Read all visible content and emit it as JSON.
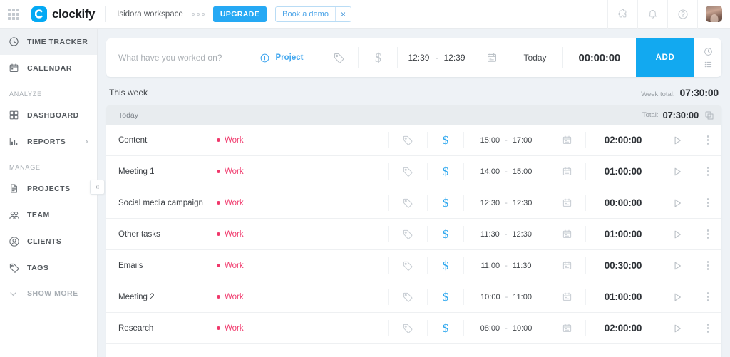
{
  "header": {
    "apps_icon": "apps-grid-icon",
    "logo_text": "clockify",
    "logo_icon": "clockify-logo-icon",
    "workspace": "Isidora workspace",
    "workspace_dots_icon": "more-dots-icon",
    "upgrade_label": "UPGRADE",
    "book_demo_label": "Book a demo",
    "book_demo_close": "×",
    "icons": {
      "extension": "puzzle-icon",
      "notifications": "bell-icon",
      "help": "help-circle-icon",
      "avatar": "user-avatar"
    }
  },
  "sidebar": {
    "items": [
      {
        "label": "TIME TRACKER",
        "icon": "clock-icon",
        "active": true
      },
      {
        "label": "CALENDAR",
        "icon": "calendar-icon",
        "active": false
      }
    ],
    "analyze_label": "ANALYZE",
    "analyze_items": [
      {
        "label": "DASHBOARD",
        "icon": "dashboard-grid-icon",
        "chevron": ""
      },
      {
        "label": "REPORTS",
        "icon": "bar-chart-icon",
        "chevron": "›"
      }
    ],
    "manage_label": "MANAGE",
    "manage_items": [
      {
        "label": "PROJECTS",
        "icon": "document-icon"
      },
      {
        "label": "TEAM",
        "icon": "team-icon"
      },
      {
        "label": "CLIENTS",
        "icon": "client-icon"
      }
    ],
    "tags_item": {
      "label": "TAGS",
      "icon": "tag-icon"
    },
    "show_more": {
      "label": "SHOW MORE",
      "icon": "chevron-down-icon"
    },
    "collapse_icon": "«"
  },
  "timer": {
    "placeholder": "What have you worked on?",
    "description_value": "",
    "project_label": "Project",
    "project_add_icon": "plus-circle-icon",
    "tag_icon": "tag-icon",
    "billable_icon": "dollar-icon",
    "start_time": "12:39",
    "time_separator": "-",
    "end_time": "12:39",
    "calendar_icon": "calendar-icon",
    "date_label": "Today",
    "duration": "00:00:00",
    "add_label": "ADD",
    "mode_timer_icon": "clock-icon",
    "mode_manual_icon": "list-icon"
  },
  "week": {
    "title": "This week",
    "total_label": "Week total:",
    "total_value": "07:30:00"
  },
  "day": {
    "name": "Today",
    "total_label": "Total:",
    "total_value": "07:30:00",
    "copy_icon": "copy-icon"
  },
  "entry_icons": {
    "tag": "tag-icon",
    "billable": "dollar-icon",
    "calendar": "calendar-icon",
    "play": "play-icon",
    "menu": "more-vertical-icon"
  },
  "entries": [
    {
      "description": "Content",
      "project": "Work",
      "start": "15:00",
      "end": "17:00",
      "duration": "02:00:00"
    },
    {
      "description": "Meeting 1",
      "project": "Work",
      "start": "14:00",
      "end": "15:00",
      "duration": "01:00:00"
    },
    {
      "description": "Social media campaign",
      "project": "Work",
      "start": "12:30",
      "end": "12:30",
      "duration": "00:00:00"
    },
    {
      "description": "Other tasks",
      "project": "Work",
      "start": "11:30",
      "end": "12:30",
      "duration": "01:00:00"
    },
    {
      "description": "Emails",
      "project": "Work",
      "start": "11:00",
      "end": "11:30",
      "duration": "00:30:00"
    },
    {
      "description": "Meeting 2",
      "project": "Work",
      "start": "10:00",
      "end": "11:00",
      "duration": "01:00:00"
    },
    {
      "description": "Research",
      "project": "Work",
      "start": "08:00",
      "end": "10:00",
      "duration": "02:00:00"
    }
  ],
  "time_separator": "-",
  "colors": {
    "brand_blue": "#03a9f4",
    "add_blue": "#12a9f0",
    "project_pink": "#f0386b",
    "billable_blue": "#2ba6ee",
    "page_bg": "#eef2f6"
  }
}
